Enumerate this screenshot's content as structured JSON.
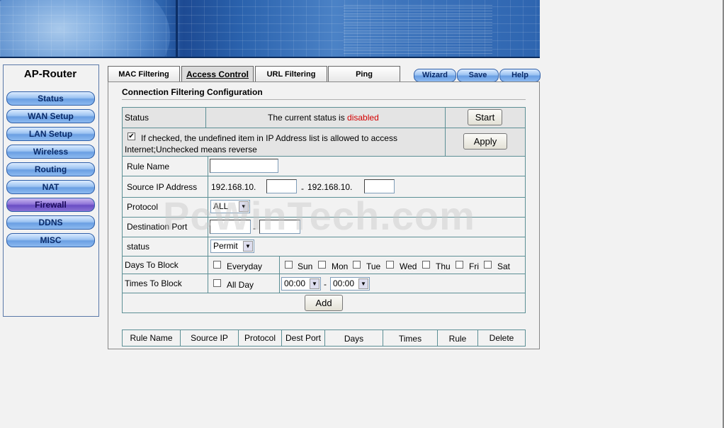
{
  "brand": {
    "title": "AP-Router"
  },
  "sidebar": {
    "items": [
      {
        "label": "Status"
      },
      {
        "label": "WAN Setup"
      },
      {
        "label": "LAN Setup"
      },
      {
        "label": "Wireless"
      },
      {
        "label": "Routing"
      },
      {
        "label": "NAT"
      },
      {
        "label": "Firewall"
      },
      {
        "label": "DDNS"
      },
      {
        "label": "MISC"
      }
    ],
    "active": "Firewall"
  },
  "tabs": [
    {
      "label": "MAC Filtering"
    },
    {
      "label": "Access Control",
      "active": true
    },
    {
      "label": "URL Filtering"
    },
    {
      "label": "Ping"
    }
  ],
  "header_buttons": {
    "wizard": "Wizard",
    "save": "Save",
    "help": "Help"
  },
  "section": {
    "title": "Connection Filtering Configuration"
  },
  "form": {
    "status_label": "Status",
    "status_text_prefix": "The current status is ",
    "status_value": "disabled",
    "start_button": "Start",
    "checkbox_text_line1": "If checked, the undefined item in IP Address list is allowed to access",
    "checkbox_text_line2": "Internet;Unchecked means reverse",
    "checkbox_checked_glyph": "✔",
    "apply_button": "Apply",
    "rule_name_label": "Rule Name",
    "source_ip_label": "Source IP Address",
    "ip_prefix_1": "192.168.10.",
    "ip_dash": "-",
    "ip_prefix_2": "192.168.10.",
    "protocol_label": "Protocol",
    "protocol_value": "ALL",
    "dest_port_label": "Destination Port",
    "dest_port_dash": "-",
    "status2_label": "status",
    "status2_value": "Permit",
    "days_label": "Days To Block",
    "everyday": "Everyday",
    "days": [
      "Sun",
      "Mon",
      "Tue",
      "Wed",
      "Thu",
      "Fri",
      "Sat"
    ],
    "times_label": "Times To Block",
    "all_day": "All Day",
    "time_from": "00:00",
    "time_dash": "-",
    "time_to": "00:00",
    "add_button": "Add"
  },
  "rules_table": {
    "headers": [
      "Rule Name",
      "Source IP",
      "Protocol",
      "Dest Port",
      "Days",
      "Times",
      "Rule",
      "Delete"
    ]
  },
  "watermark": "PcWinTech.com",
  "icons": {
    "dropdown": "▼"
  }
}
